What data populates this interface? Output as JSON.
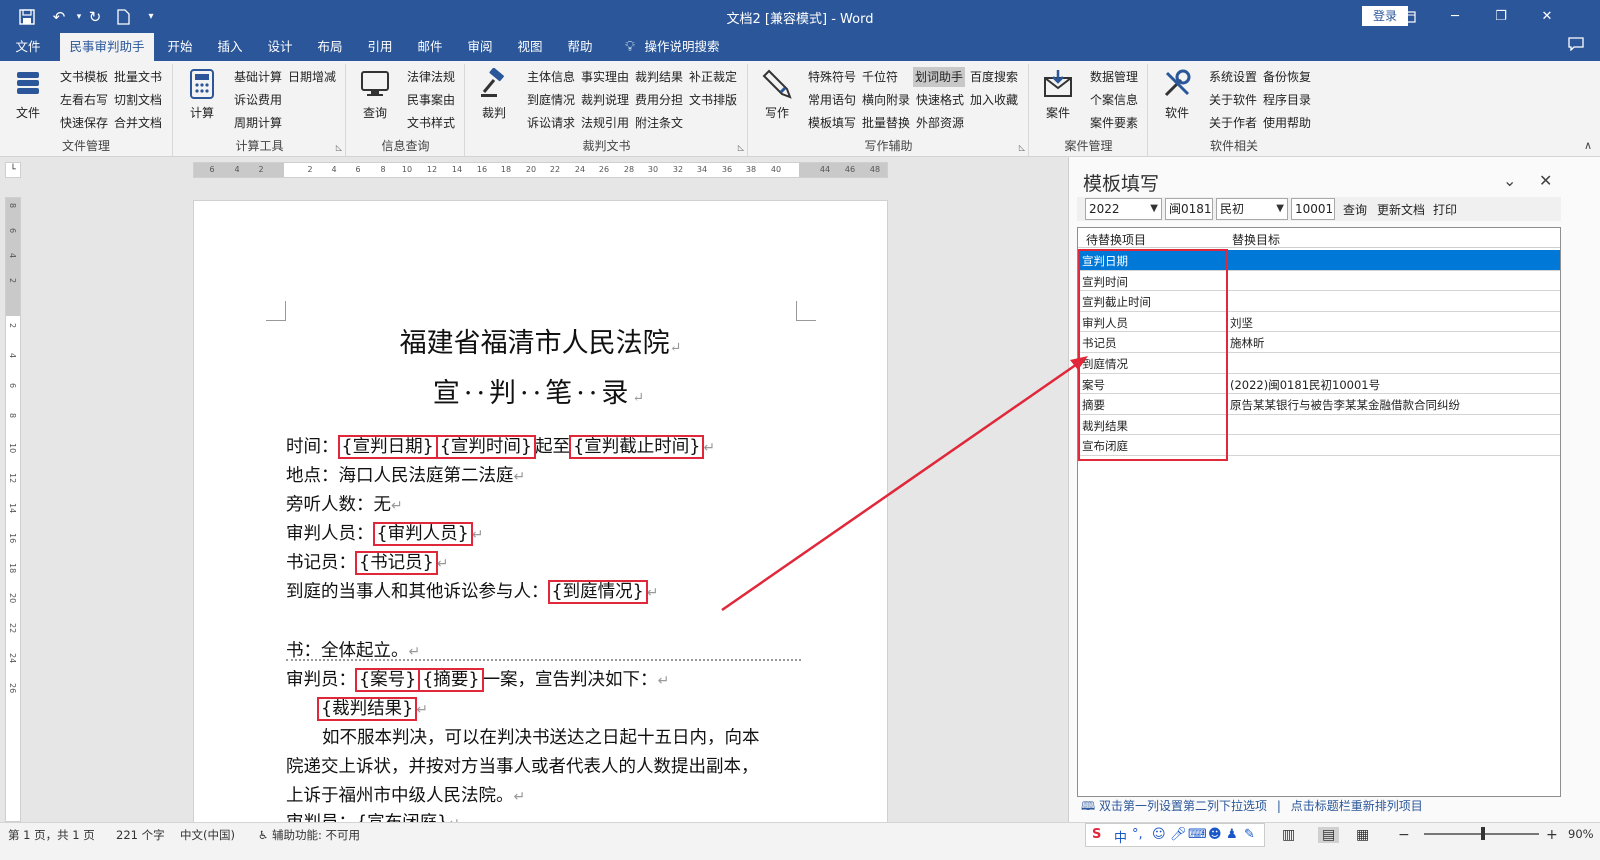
{
  "window": {
    "title": "文档2 [兼容模式] - Word",
    "login_label": "登录"
  },
  "menu_tabs": [
    {
      "label": "文件"
    },
    {
      "label": "民事审判助手"
    },
    {
      "label": "开始"
    },
    {
      "label": "插入"
    },
    {
      "label": "设计"
    },
    {
      "label": "布局"
    },
    {
      "label": "引用"
    },
    {
      "label": "邮件"
    },
    {
      "label": "审阅"
    },
    {
      "label": "视图"
    },
    {
      "label": "帮助"
    },
    {
      "label": "操作说明搜索"
    }
  ],
  "ribbon": {
    "groups": [
      {
        "title": "文件管理",
        "big": "文件",
        "items": [
          "文书模板",
          "批量文书",
          "左看右写",
          "切割文档",
          "快速保存",
          "合并文档"
        ]
      },
      {
        "title": "计算工具",
        "big": "计算",
        "items": [
          "基础计算",
          "日期增减",
          "诉讼费用",
          "周期计算"
        ]
      },
      {
        "title": "信息查询",
        "big": "查询",
        "items": [
          "法律法规",
          "民事案由",
          "文书样式"
        ]
      },
      {
        "title": "裁判文书",
        "big": "裁判",
        "items": [
          "主体信息",
          "事实理由",
          "裁判结果",
          "补正裁定",
          "到庭情况",
          "裁判说理",
          "费用分担",
          "文书排版",
          "诉讼请求",
          "法规引用",
          "附注条文"
        ]
      },
      {
        "title": "写作辅助",
        "big": "写作",
        "items": [
          "特殊符号",
          "千位符",
          "划词助手",
          "百度搜索",
          "常用语句",
          "横向附录",
          "快速格式",
          "加入收藏",
          "模板填写",
          "批量替换",
          "外部资源"
        ]
      },
      {
        "title": "案件管理",
        "big": "案件",
        "items": [
          "数据管理",
          "个案信息",
          "案件要素"
        ]
      },
      {
        "title": "软件相关",
        "big": "软件",
        "items": [
          "系统设置",
          "备份恢复",
          "关于软件",
          "程序目录",
          "关于作者",
          "使用帮助"
        ]
      }
    ]
  },
  "ruler": {
    "h_ticks": [
      "6",
      "4",
      "2",
      "2",
      "4",
      "6",
      "8",
      "10",
      "12",
      "14",
      "16",
      "18",
      "20",
      "22",
      "24",
      "26",
      "28",
      "30",
      "32",
      "34",
      "36",
      "38",
      "40",
      "44",
      "46",
      "48"
    ],
    "v_ticks": [
      "8",
      "6",
      "4",
      "2",
      "2",
      "4",
      "6",
      "8",
      "10",
      "12",
      "14",
      "16",
      "18",
      "20",
      "22",
      "24",
      "26"
    ]
  },
  "document": {
    "title1": "福建省福清市人民法院",
    "title2": "宣··判··笔··录",
    "lines": {
      "time_label": "时间：",
      "time_ph1": "{宣判日期}",
      "time_ph2": "{宣判时间}",
      "time_mid": "起至",
      "time_ph3": "{宣判截止时间}",
      "place": "地点：海口人民法庭第二法庭",
      "audience": "旁听人数：无",
      "judge_label": "审判人员：",
      "judge_ph": "{审判人员}",
      "clerk_label": "书记员：",
      "clerk_ph": "{书记员}",
      "present_label": "到庭的当事人和其他诉讼参与人：",
      "present_ph": "{到庭情况}",
      "rise": "书：全体起立。",
      "judge2_label": "审判员：",
      "case_ph": "{案号}",
      "summary_ph": "{摘要}",
      "judge2_tail": "一案，宣告判决如下：",
      "result_ph": "{裁判结果}",
      "appeal1": "如不服本判决，可以在判决书送达之日起十五日内，向本",
      "appeal2": "院递交上诉状，并按对方当事人或者代表人的人数提出副本，",
      "appeal3": "上诉于福州市中级人民法院。",
      "close_label": "审判员：",
      "close_ph": "{宣布闭庭}",
      "para_mark": "↵"
    }
  },
  "pane": {
    "title": "模板填写",
    "year": "2022",
    "court": "闽0181",
    "case_type": "民初",
    "case_no": "10001",
    "query_btn": "查询",
    "update_btn": "更新文档",
    "print_btn": "打印",
    "col1": "待替换项目",
    "col2": "替换目标",
    "rows": [
      {
        "item": "宣判日期",
        "target": ""
      },
      {
        "item": "宣判时间",
        "target": ""
      },
      {
        "item": "宣判截止时间",
        "target": ""
      },
      {
        "item": "审判人员",
        "target": "刘坚"
      },
      {
        "item": "书记员",
        "target": "施林昕"
      },
      {
        "item": "到庭情况",
        "target": ""
      },
      {
        "item": "案号",
        "target": "(2022)闽0181民初10001号"
      },
      {
        "item": "摘要",
        "target": "原告某某银行与被告李某某金融借款合同纠纷"
      },
      {
        "item": "裁判结果",
        "target": ""
      },
      {
        "item": "宣布闭庭",
        "target": ""
      }
    ],
    "footer1": "双击第一列设置第二列下拉选项",
    "footer_sep": "|",
    "footer2": "点击标题栏重新排列项目"
  },
  "status": {
    "page": "第 1 页，共 1 页",
    "words": "221 个字",
    "lang": "中文(中国)",
    "accessibility": "辅助功能: 不可用",
    "zoom": "90%",
    "ime_lang": "中"
  },
  "colors": {
    "brand": "#2b579a",
    "highlight_red": "#e0283a",
    "selection": "#0078d7"
  }
}
